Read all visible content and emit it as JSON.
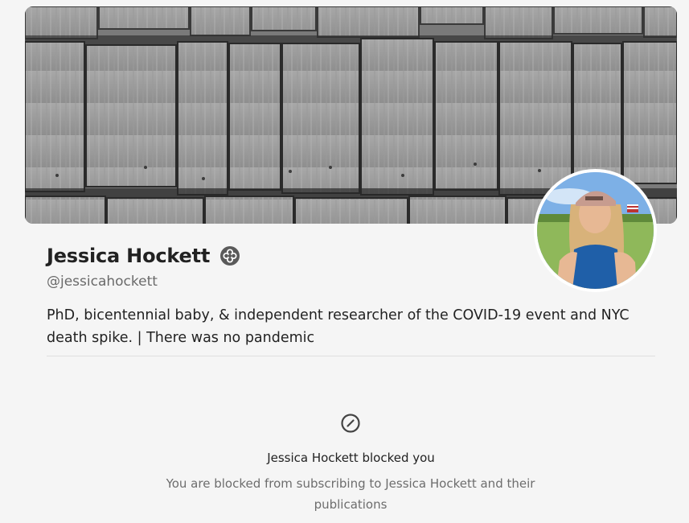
{
  "profile": {
    "name": "Jessica Hockett",
    "handle": "@jessicahockett",
    "bio": "PhD, bicentennial baby, & independent researcher of the COVID-19 event and NYC death spike. | There was no pandemic",
    "badge_icon": "bestseller-badge-icon",
    "cover_icon": "wood-shingles-cover-image",
    "avatar_icon": "profile-photo"
  },
  "blocked": {
    "icon": "blocked-circle-icon",
    "title": "Jessica Hockett blocked you",
    "description": "You are blocked from subscribing to Jessica Hockett and their publications"
  },
  "colors": {
    "background": "#f5f5f5",
    "text_primary": "#222222",
    "text_secondary": "#6d6d6d",
    "badge": "#5a5a5a"
  }
}
